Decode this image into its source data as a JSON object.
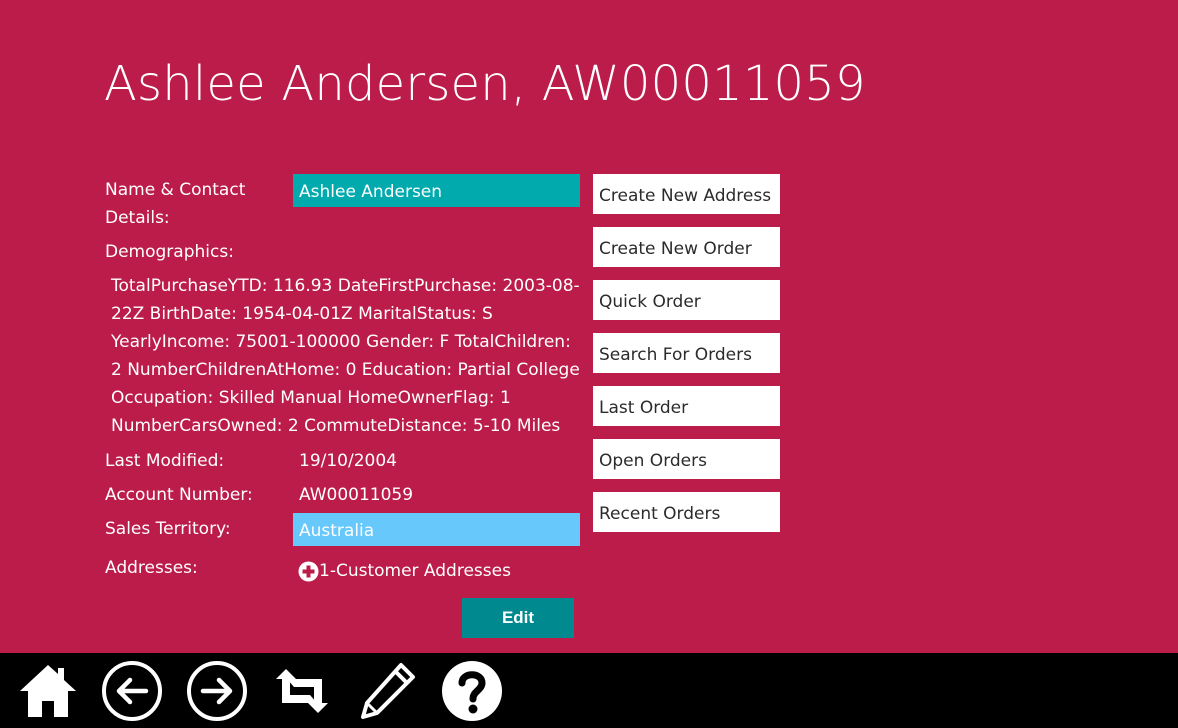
{
  "page": {
    "title": "Ashlee Andersen, AW00011059"
  },
  "form": {
    "name_label": "Name & Contact Details:",
    "name_value": "Ashlee Andersen",
    "demographics_label": "Demographics:",
    "demographics_text": "TotalPurchaseYTD: 116.93 DateFirstPurchase: 2003-08-22Z BirthDate: 1954-04-01Z MaritalStatus: S YearlyIncome: 75001-100000 Gender: F TotalChildren: 2 NumberChildrenAtHome: 0 Education: Partial College Occupation: Skilled Manual HomeOwnerFlag: 1 NumberCarsOwned: 2 CommuteDistance: 5-10 Miles",
    "last_modified_label": "Last Modified:",
    "last_modified_value": "19/10/2004",
    "account_number_label": "Account Number:",
    "account_number_value": "AW00011059",
    "sales_territory_label": "Sales Territory:",
    "sales_territory_value": "Australia",
    "addresses_label": "Addresses:",
    "addresses_link": "1-Customer Addresses",
    "edit_label": "Edit"
  },
  "actions": [
    {
      "label": "Create New Address"
    },
    {
      "label": "Create New Order"
    },
    {
      "label": "Quick Order"
    },
    {
      "label": "Search For Orders"
    },
    {
      "label": "Last Order"
    },
    {
      "label": "Open Orders"
    },
    {
      "label": "Recent Orders"
    }
  ],
  "bottom_bar": {
    "icons": [
      "home-icon",
      "back-arrow-icon",
      "forward-arrow-icon",
      "refresh-icon",
      "edit-pencil-icon",
      "help-icon"
    ]
  },
  "colors": {
    "background": "#bc1c4a",
    "name_field": "#00aaad",
    "territory_field": "#66c8fb",
    "edit_button": "#008a8f",
    "bottom_bar": "#000000"
  }
}
